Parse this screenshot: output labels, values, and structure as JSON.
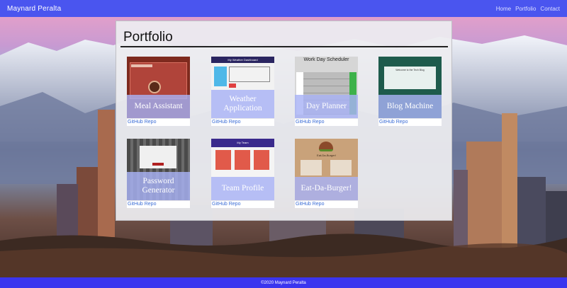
{
  "navbar": {
    "brand": "Maynard Peralta",
    "links": [
      "Home",
      "Portfolio",
      "Contact"
    ]
  },
  "main": {
    "title": "Portfolio",
    "repo_label": "GitHub Repo",
    "projects": [
      {
        "title": "Meal Assistant",
        "thumb_colors": [
          "#8c2e1f",
          "#b8473a"
        ]
      },
      {
        "title": "Weather Application",
        "thumb_colors": [
          "#1f1a4d",
          "#4fb8e8"
        ]
      },
      {
        "title": "Day Planner",
        "thumb_colors": [
          "#d8d8d8",
          "#3db24a"
        ]
      },
      {
        "title": "Blog Machine",
        "thumb_colors": [
          "#1e5b4c",
          "#2c8f7a"
        ]
      },
      {
        "title": "Password Generator",
        "thumb_colors": [
          "#5a5a5a",
          "#9a9a9a"
        ]
      },
      {
        "title": "Team Profile",
        "thumb_colors": [
          "#3a2a8c",
          "#e15a4a"
        ]
      },
      {
        "title": "Eat-Da-Burger!",
        "thumb_colors": [
          "#c7a57a",
          "#8b5a3a"
        ]
      }
    ]
  },
  "thumb_text": {
    "weather": "My Weather Dashboard",
    "planner": "Work Day Scheduler",
    "blog": "Welcome to the Tech Blog",
    "team": "My Team",
    "burger": "Eat-Da-Burger!"
  },
  "footer": {
    "text": "©2020 Maynard Peralta"
  },
  "colors": {
    "nav": "#4a55ef",
    "footer": "#3a35ef",
    "overlay": "#a8b2f5",
    "link": "#3a6cd6"
  }
}
